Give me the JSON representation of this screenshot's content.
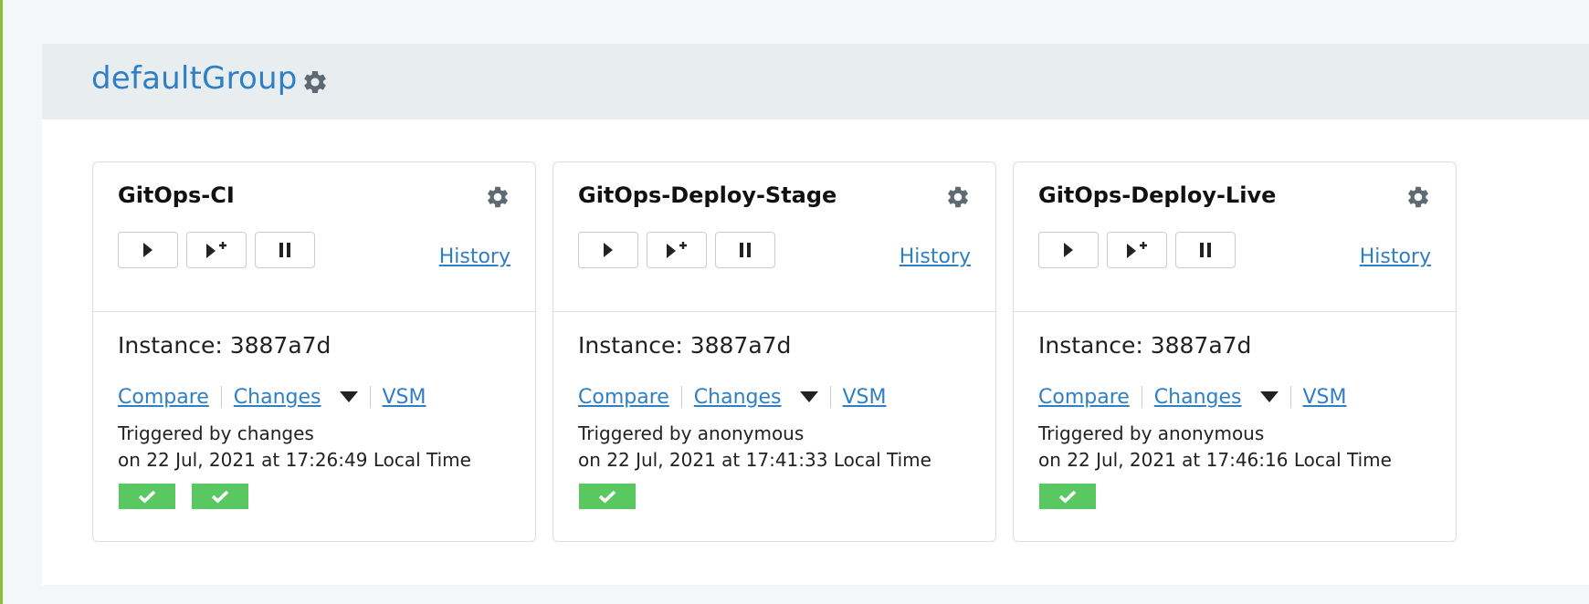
{
  "group": {
    "title": "defaultGroup",
    "settings_icon": "gear-icon"
  },
  "colors": {
    "accent_link": "#2f7fc4",
    "stage_passed": "#5ac860",
    "header_bg": "#e8edf0",
    "left_accent": "#8bbf3a"
  },
  "pipelines": [
    {
      "name": "GitOps-CI",
      "history_label": "History",
      "instance_label": "Instance: 3887a7d",
      "compare_label": "Compare",
      "changes_label": "Changes",
      "vsm_label": "VSM",
      "triggered_by": "Triggered by changes",
      "triggered_on": "on 22 Jul, 2021 at 17:26:49 Local Time",
      "stages": [
        "passed",
        "passed"
      ]
    },
    {
      "name": "GitOps-Deploy-Stage",
      "history_label": "History",
      "instance_label": "Instance: 3887a7d",
      "compare_label": "Compare",
      "changes_label": "Changes",
      "vsm_label": "VSM",
      "triggered_by": "Triggered by anonymous",
      "triggered_on": "on 22 Jul, 2021 at 17:41:33 Local Time",
      "stages": [
        "passed"
      ]
    },
    {
      "name": "GitOps-Deploy-Live",
      "history_label": "History",
      "instance_label": "Instance: 3887a7d",
      "compare_label": "Compare",
      "changes_label": "Changes",
      "vsm_label": "VSM",
      "triggered_by": "Triggered by anonymous",
      "triggered_on": "on 22 Jul, 2021 at 17:46:16 Local Time",
      "stages": [
        "passed"
      ]
    }
  ],
  "icons": {
    "trigger": "play-icon",
    "trigger_with_options": "play-with-options-icon",
    "pause": "pause-icon",
    "settings": "gear-icon",
    "changes_dropdown": "caret-down-icon",
    "stage_status": "checkmark-icon"
  }
}
